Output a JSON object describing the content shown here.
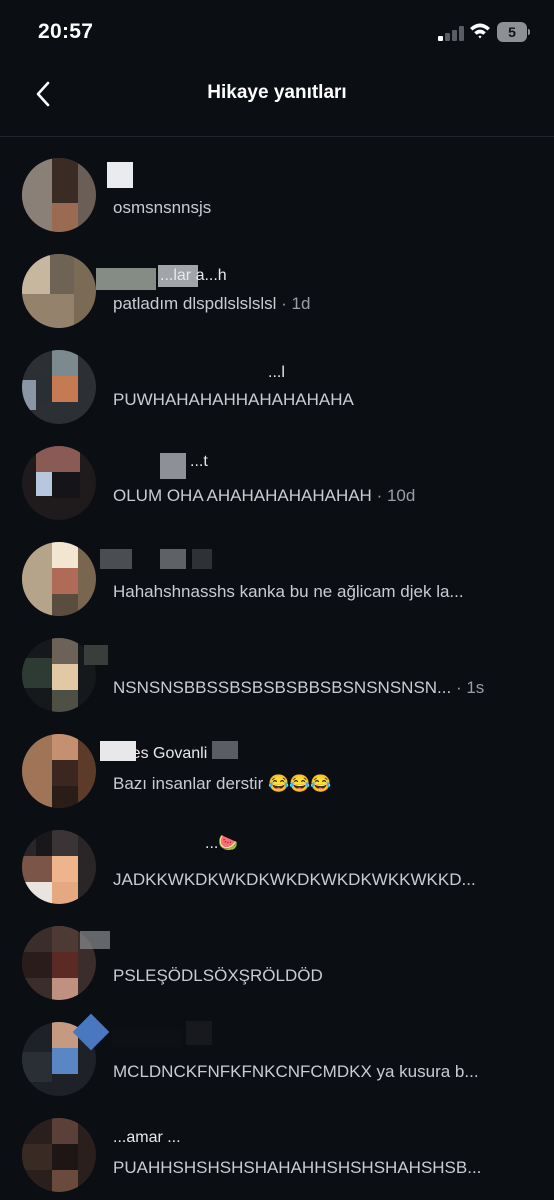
{
  "status_bar": {
    "time": "20:57",
    "battery_level": "5",
    "signal_bars_on": 1,
    "signal_bars_total": 4
  },
  "header": {
    "title": "Hikaye yanıtları",
    "back_icon": "chevron-left-icon"
  },
  "replies": [
    {
      "username": "",
      "text": "osmsnsnnsjs",
      "time": ""
    },
    {
      "username": "...lar a...h",
      "text": "patladım dlspdlslslslsl",
      "time": " · 1d"
    },
    {
      "username": "...l",
      "text": "PUWHAHAHAHHAHAHAHAHA",
      "time": ""
    },
    {
      "username": "...t",
      "text": "OLUM OHA AHAHAHAHAHAHAH",
      "time": " · 10d"
    },
    {
      "username": "",
      "text": "Hahahshnasshs kanka bu ne ağlicam djek la...",
      "time": ""
    },
    {
      "username": "",
      "text": "NSNSNSBBSSBSBSBSBBSBSNSNSNSN...",
      "time": " · 1s"
    },
    {
      "username": "Zhes Govanli",
      "text": "Bazı insanlar derstir 😂😂😂",
      "time": ""
    },
    {
      "username": "...🍉",
      "text": "JADKKWKDKWKDKWKDKWKDKWKKWKKD...",
      "time": ""
    },
    {
      "username": "",
      "text": "PSLEŞÖDLSÖXŞRÖLDÖD",
      "time": ""
    },
    {
      "username": "",
      "text": "MCLDNCKFNFKFNKCNFCMDKX ya kusura b...",
      "time": ""
    },
    {
      "username": "...amar ...",
      "text": "PUAHHSHSHSHSHAHAHHSHSHSHAHSHSB...",
      "time": ""
    }
  ],
  "colors": {
    "background": "#0b0e13",
    "text_primary": "#ffffff",
    "text_secondary": "#c9ccd3",
    "divider": "#1f242b"
  }
}
